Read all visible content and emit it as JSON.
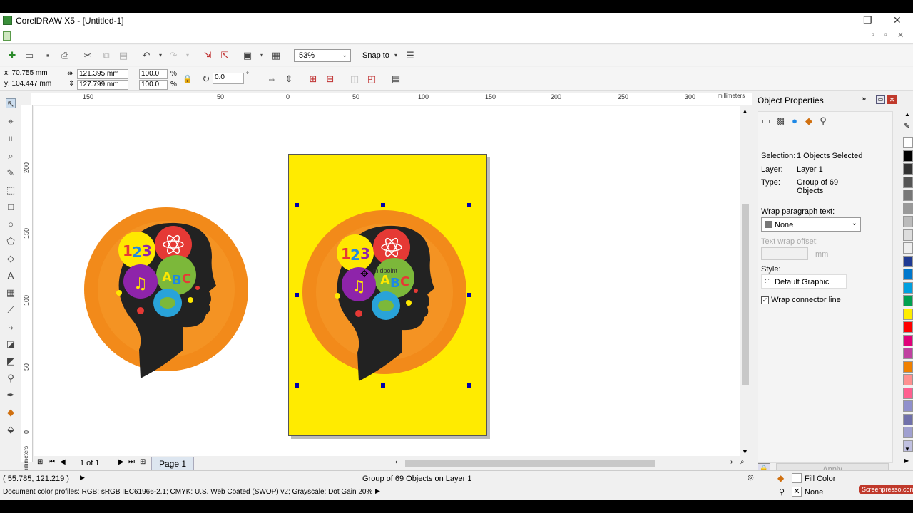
{
  "window": {
    "title": "CorelDRAW X5 - [Untitled-1]"
  },
  "toolbar": {
    "zoom": "53%",
    "snap_to": "Snap to"
  },
  "props": {
    "x": "x: 70.755 mm",
    "y": "y: 104.447 mm",
    "w": "121.395 mm",
    "h": "127.799 mm",
    "sx": "100.0",
    "sy": "100.0",
    "pct": "%",
    "angle": "0.0"
  },
  "ruler": {
    "units": "millimeters",
    "h_ticks": [
      "150",
      "50",
      "0",
      "50",
      "100",
      "150",
      "200",
      "250",
      "300"
    ],
    "v_ticks": [
      "200",
      "150",
      "100",
      "50",
      "0"
    ],
    "v_units": "millimeters"
  },
  "canvas": {
    "cursor_hint": "midpoint"
  },
  "nav": {
    "page_count": "1 of 1",
    "page_tab": "Page 1"
  },
  "docker": {
    "title": "Object Properties",
    "selection_label": "Selection:",
    "selection_value": "1 Objects Selected",
    "layer_label": "Layer:",
    "layer_value": "Layer 1",
    "type_label": "Type:",
    "type_value": "Group of 69 Objects",
    "wrap_label": "Wrap paragraph text:",
    "wrap_value": "None",
    "offset_label": "Text wrap offset:",
    "offset_unit": "mm",
    "style_label": "Style:",
    "style_value": "Default Graphic",
    "connector_label": "Wrap connector line",
    "apply": "Apply"
  },
  "status": {
    "coords": "( 55.785, 121.219 )",
    "object_info": "Group of 69 Objects on Layer 1",
    "profiles": "Document color profiles: RGB: sRGB IEC61966-2.1; CMYK: U.S. Web Coated (SWOP) v2; Grayscale: Dot Gain 20%",
    "fill": "Fill Color",
    "outline": "None",
    "watermark": "Screenpresso.com"
  },
  "colors": {
    "page": "#ffeb00",
    "palette": [
      "#ffffff",
      "#000000",
      "#333333",
      "#555555",
      "#777777",
      "#999999",
      "#bbbbbb",
      "#dddddd",
      "#eeeeee",
      "#1f3a93",
      "#0077cc",
      "#00a0e0",
      "#00a050",
      "#ffee00",
      "#ff0000",
      "#e0007a",
      "#c040a0",
      "#f08000",
      "#ff9090",
      "#ff6090",
      "#9090cc",
      "#7070aa",
      "#a0a0d0",
      "#c0c0e0"
    ]
  }
}
